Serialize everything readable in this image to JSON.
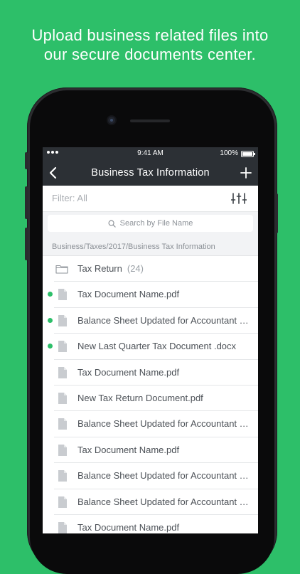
{
  "headline": {
    "line1": "Upload business related files into",
    "line2": "our secure documents center."
  },
  "status_bar": {
    "time": "9:41 AM",
    "battery": "100%"
  },
  "nav": {
    "title": "Business Tax Information"
  },
  "filter": {
    "label": "Filter: All"
  },
  "search": {
    "placeholder": "Search by File Name"
  },
  "breadcrumb": "Business/Taxes/2017/Business Tax Information",
  "folder": {
    "name": "Tax Return",
    "count": "(24)"
  },
  "files": [
    {
      "name": "Tax Document Name.pdf",
      "new": true
    },
    {
      "name": "Balance Sheet Updated for Accountant Review.xlsx",
      "new": true
    },
    {
      "name": "New Last Quarter Tax Document .docx",
      "new": true
    },
    {
      "name": "Tax Document Name.pdf",
      "new": false
    },
    {
      "name": "New Tax Return Document.pdf",
      "new": false
    },
    {
      "name": "Balance Sheet Updated for Accountant Review.xlsx",
      "new": false
    },
    {
      "name": "Tax Document Name.pdf",
      "new": false
    },
    {
      "name": "Balance Sheet Updated for Accountant Review.xlsx",
      "new": false
    },
    {
      "name": "Balance Sheet Updated for Accountant Review.xlsx",
      "new": false
    },
    {
      "name": "Tax Document Name.pdf",
      "new": false
    }
  ],
  "colors": {
    "brand_green": "#2dbf69",
    "navbar": "#2c3035"
  },
  "icons": {
    "back": "chevron-left-icon",
    "add": "plus-icon",
    "filter": "sliders-icon",
    "search": "magnifier-icon",
    "folder": "folder-icon",
    "file": "document-icon"
  }
}
